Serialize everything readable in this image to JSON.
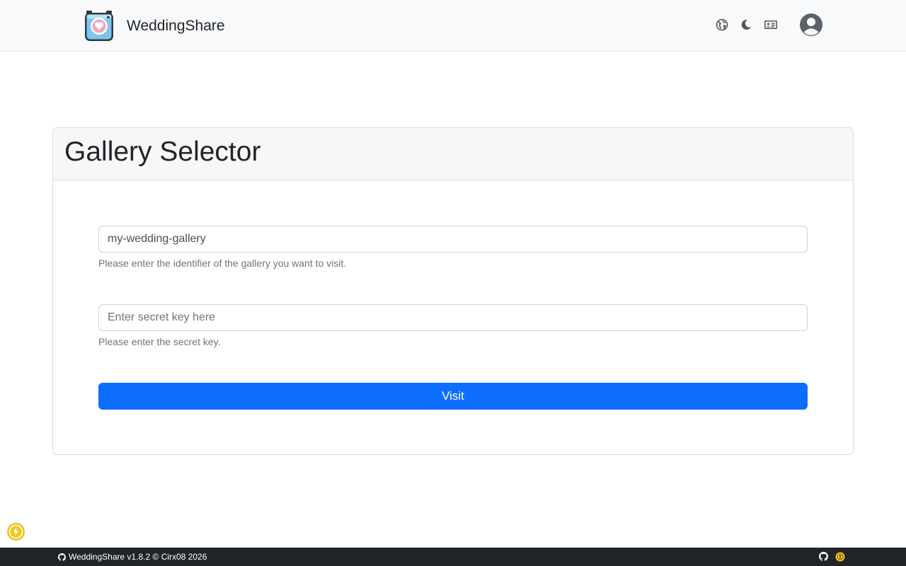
{
  "app": {
    "name": "WeddingShare",
    "colors": {
      "primary": "#0d6efd",
      "navbar_bg": "#f8f9fa",
      "footer_bg": "#212529",
      "accent_yellow": "#f0c419"
    }
  },
  "navbar": {
    "brand": "WeddingShare",
    "logo_icon": "camera-heart-icon",
    "icons": [
      "language-globe-icon",
      "dark-mode-moon-icon",
      "id-card-icon",
      "account-avatar-icon"
    ]
  },
  "card": {
    "title": "Gallery Selector",
    "gallery_input": {
      "value": "my-wedding-gallery",
      "placeholder": "",
      "help": "Please enter the identifier of the gallery you want to visit."
    },
    "secret_input": {
      "value": "",
      "placeholder": "Enter secret key here",
      "help": "Please enter the secret key."
    },
    "visit_label": "Visit"
  },
  "floating": {
    "icon": "lightning-bolt-icon"
  },
  "footer": {
    "text": "WeddingShare v1.8.2 © Cirx08 2026",
    "icons": [
      "github-icon",
      "sponsor-coin-icon"
    ]
  }
}
